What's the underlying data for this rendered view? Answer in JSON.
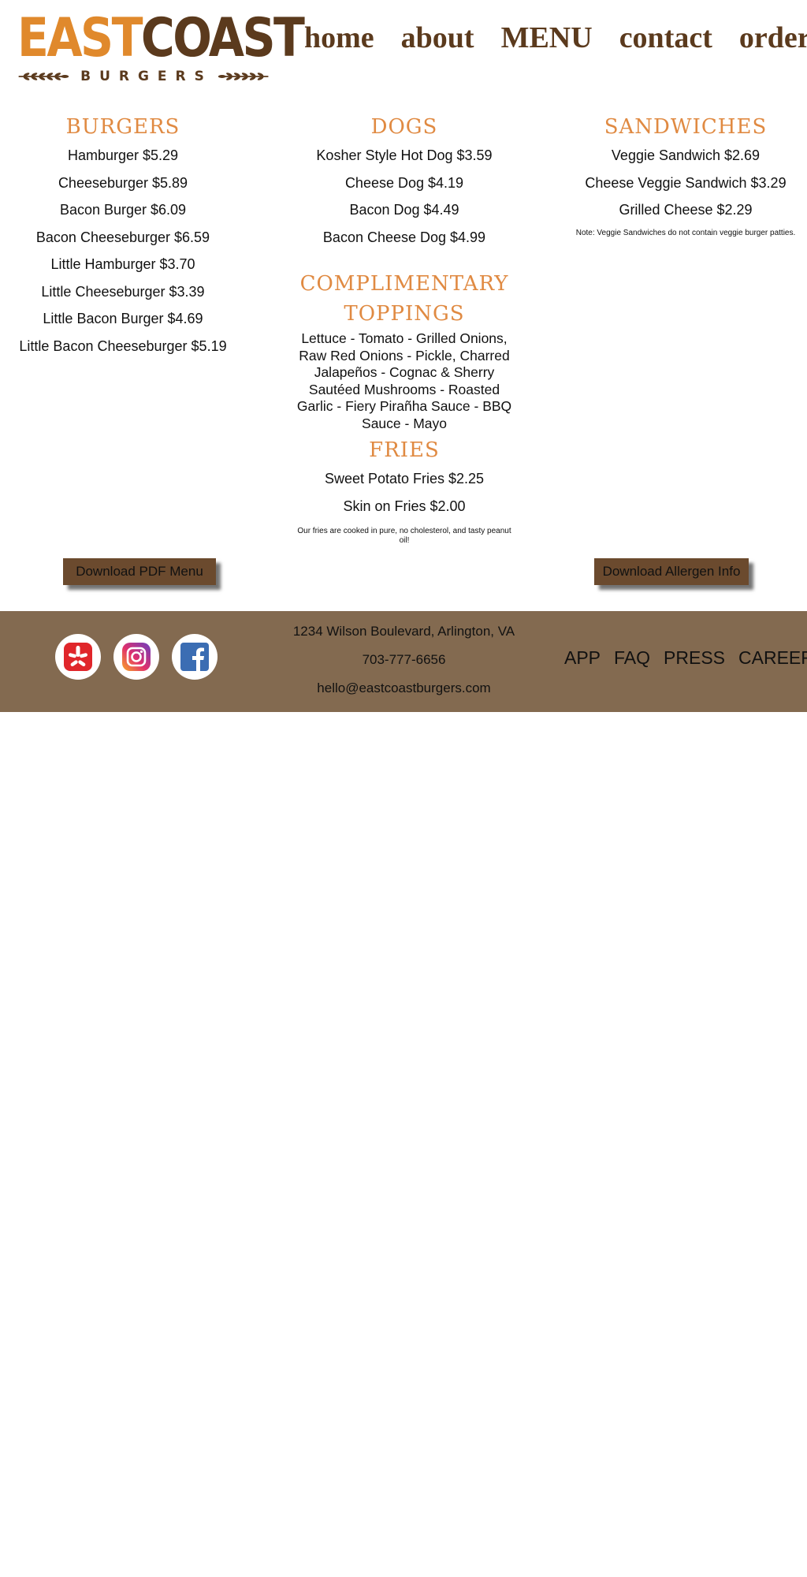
{
  "brand": {
    "logo_word1": "EAST",
    "logo_word2": "COAST",
    "logo_sub": "BURGERS",
    "colors": {
      "orange": "#e0892c",
      "brown": "#5b3a1d",
      "footer": "#836a50",
      "button": "#6b4a2e"
    }
  },
  "nav": [
    {
      "label": "home"
    },
    {
      "label": "about"
    },
    {
      "label": "MENU"
    },
    {
      "label": "contact"
    },
    {
      "label": "order"
    }
  ],
  "menu": {
    "burgers": {
      "title": "BURGERS",
      "items": [
        "Hamburger $5.29",
        "Cheeseburger $5.89",
        "Bacon Burger $6.09",
        "Bacon Cheeseburger $6.59",
        "Little Hamburger $3.70",
        "Little Cheeseburger $3.39",
        "Little Bacon Burger $4.69",
        "Little Bacon Cheeseburger $5.19"
      ]
    },
    "dogs": {
      "title": "DOGS",
      "items": [
        "Kosher Style Hot Dog $3.59",
        "Cheese Dog $4.19",
        "Bacon Dog $4.49",
        "Bacon Cheese Dog $4.99"
      ]
    },
    "sandwiches": {
      "title": "SANDWICHES",
      "items": [
        "Veggie Sandwich $2.69",
        "Cheese Veggie Sandwich $3.29",
        "Grilled Cheese $2.29"
      ],
      "note": "Note: Veggie Sandwiches do not contain veggie burger patties."
    },
    "toppings": {
      "title": "COMPLIMENTARY TOPPINGS",
      "text": "Lettuce - Tomato - Grilled Onions, Raw Red Onions - Pickle, Charred Jalapeños - Cognac & Sherry Sautéed Mushrooms - Roasted Garlic - Fiery Pirañha Sauce - BBQ Sauce - Mayo"
    },
    "fries": {
      "title": "FRIES",
      "items": [
        "Sweet Potato Fries $2.25",
        "Skin on Fries $2.00"
      ],
      "note": "Our fries are cooked in pure, no cholesterol, and tasty peanut oil!"
    }
  },
  "buttons": {
    "pdf": "Download PDF Menu",
    "allergen": "Download Allergen Info"
  },
  "footer": {
    "social": [
      {
        "icon": "yelp-icon"
      },
      {
        "icon": "instagram-icon"
      },
      {
        "icon": "facebook-icon"
      }
    ],
    "address": "1234 Wilson Boulevard, Arlington, VA",
    "phone": "703-777-6656",
    "email": "hello@eastcoastburgers.com",
    "links": [
      "APP",
      "FAQ",
      "PRESS",
      "CAREERS"
    ]
  }
}
